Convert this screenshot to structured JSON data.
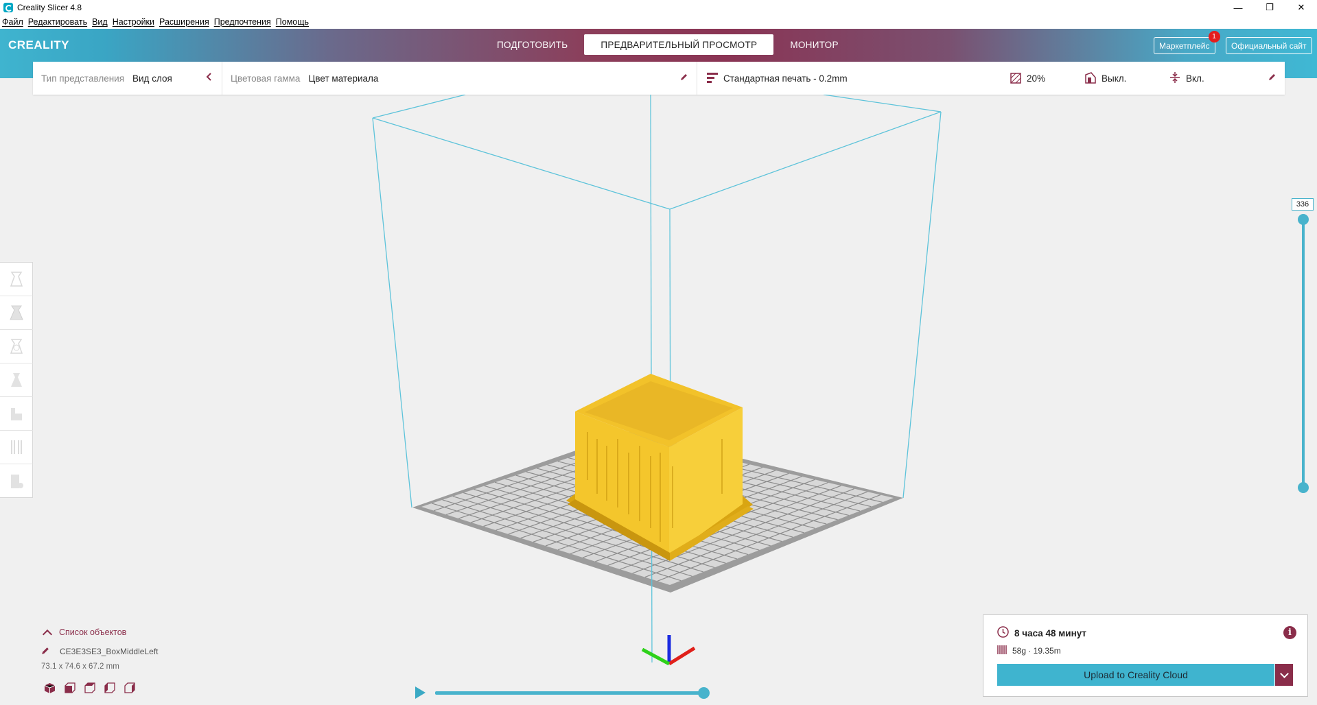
{
  "window": {
    "title": "Creality Slicer 4.8",
    "controls": {
      "minimize": "—",
      "maximize": "❐",
      "close": "✕"
    }
  },
  "menu": [
    "Файл",
    "Редактировать",
    "Вид",
    "Настройки",
    "Расширения",
    "Предпочтения",
    "Помощь"
  ],
  "header": {
    "logo": "CREALITY",
    "stages": [
      {
        "label": "ПОДГОТОВИТЬ",
        "active": false
      },
      {
        "label": "ПРЕДВАРИТЕЛЬНЫЙ ПРОСМОТР",
        "active": true
      },
      {
        "label": "МОНИТОР",
        "active": false
      }
    ],
    "marketplace_label": "Маркетплейс",
    "marketplace_badge": "1",
    "official_site_label": "Официальный сайт"
  },
  "settings_bar": {
    "view_type_label": "Тип представления",
    "view_type_value": "Вид слоя",
    "color_scheme_label": "Цветовая гамма",
    "color_scheme_value": "Цвет материала",
    "profile": "Стандартная печать - 0.2mm",
    "infill": "20%",
    "support": "Выкл.",
    "adhesion": "Вкл."
  },
  "tools": [
    "scale-tool-icon",
    "mirror-tool-icon",
    "rotate-tool-icon",
    "per-model-settings-icon",
    "support-blocker-icon",
    "multiply-icon",
    "paint-icon"
  ],
  "layer_slider": {
    "max_label": "336",
    "upper_fraction": 1.0,
    "lower_fraction": 0.0
  },
  "playback": {
    "progress": 1.0
  },
  "object_list": {
    "header": "Список объектов",
    "object_name": "CE3E3SE3_BoxMiddleLeft",
    "dimensions": "73.1 x 74.6 x 67.2 mm",
    "view_buttons": [
      "view-3d-icon",
      "view-front-icon",
      "view-top-icon",
      "view-left-icon",
      "view-right-icon"
    ]
  },
  "print_info": {
    "time": "8 часа 48 минут",
    "material": "58g · 19.35m",
    "upload_label": "Upload to Creality Cloud"
  },
  "colors": {
    "accent_cyan": "#48b3cc",
    "accent_maroon": "#8a2d4a",
    "model_yellow": "#f4c62c"
  }
}
